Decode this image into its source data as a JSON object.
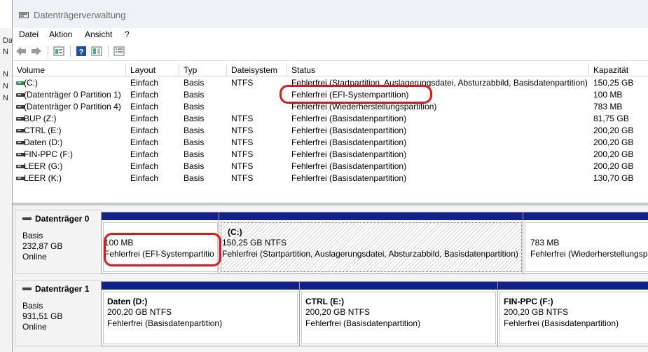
{
  "window": {
    "title": "Datenträgerverwaltung"
  },
  "bg_window": {
    "texts": [
      "Da",
      "N",
      "N",
      "N",
      "N"
    ]
  },
  "menu": [
    "Datei",
    "Aktion",
    "Ansicht",
    "?"
  ],
  "toolbar": {
    "icons": [
      "back-arrow-icon",
      "forward-arrow-icon",
      "properties-icon",
      "help-icon",
      "view-icon",
      "list-icon"
    ]
  },
  "volume_list": {
    "columns": [
      "Volume",
      "Layout",
      "Typ",
      "Dateisystem",
      "Status",
      "Kapazität"
    ],
    "rows": [
      {
        "volume": "(C:)",
        "layout": "Einfach",
        "typ": "Basis",
        "fs": "NTFS",
        "status": "Fehlerfrei (Startpartition, Auslagerungsdatei, Absturzabbild, Basisdatenpartition)",
        "cap": "150,25 GB"
      },
      {
        "volume": "(Datenträger 0 Partition 1)",
        "layout": "Einfach",
        "typ": "Basis",
        "fs": "",
        "status": "Fehlerfrei (EFI-Systempartition)",
        "cap": "100 MB"
      },
      {
        "volume": "(Datenträger 0 Partition 4)",
        "layout": "Einfach",
        "typ": "Basis",
        "fs": "",
        "status": "Fehlerfrei (Wiederherstellungspartition)",
        "cap": "783 MB"
      },
      {
        "volume": "BUP (Z:)",
        "layout": "Einfach",
        "typ": "Basis",
        "fs": "NTFS",
        "status": "Fehlerfrei (Basisdatenpartition)",
        "cap": "81,75 GB"
      },
      {
        "volume": "CTRL (E:)",
        "layout": "Einfach",
        "typ": "Basis",
        "fs": "NTFS",
        "status": "Fehlerfrei (Basisdatenpartition)",
        "cap": "200,20 GB"
      },
      {
        "volume": "Daten (D:)",
        "layout": "Einfach",
        "typ": "Basis",
        "fs": "NTFS",
        "status": "Fehlerfrei (Basisdatenpartition)",
        "cap": "200,20 GB"
      },
      {
        "volume": "FIN-PPC (F:)",
        "layout": "Einfach",
        "typ": "Basis",
        "fs": "NTFS",
        "status": "Fehlerfrei (Basisdatenpartition)",
        "cap": "200,20 GB"
      },
      {
        "volume": "LEER (G:)",
        "layout": "Einfach",
        "typ": "Basis",
        "fs": "NTFS",
        "status": "Fehlerfrei (Basisdatenpartition)",
        "cap": "200,20 GB"
      },
      {
        "volume": "LEER (K:)",
        "layout": "Einfach",
        "typ": "Basis",
        "fs": "NTFS",
        "status": "Fehlerfrei (Basisdatenpartition)",
        "cap": "130,70 GB"
      }
    ]
  },
  "disks": [
    {
      "name": "Datenträger 0",
      "type": "Basis",
      "size": "232,87 GB",
      "state": "Online",
      "partitions": [
        {
          "label": "",
          "size": "100 MB",
          "status": "Fehlerfrei (EFI-Systempartitio"
        },
        {
          "label": "(C:)",
          "size": "150,25 GB NTFS",
          "status": "Fehlerfrei (Startpartition, Auslagerungsdatei, Absturzabbild, Basisdatenpartition)"
        },
        {
          "label": "",
          "size": "783 MB",
          "status": "Fehlerfrei (Wiederherstellungspa"
        }
      ]
    },
    {
      "name": "Datenträger 1",
      "type": "Basis",
      "size": "931,51 GB",
      "state": "Online",
      "partitions": [
        {
          "label": "Daten  (D:)",
          "size": "200,20 GB NTFS",
          "status": "Fehlerfrei (Basisdatenpartition)"
        },
        {
          "label": "CTRL  (E:)",
          "size": "200,20 GB NTFS",
          "status": "Fehlerfrei (Basisdatenpartition)"
        },
        {
          "label": "FIN-PPC  (F:)",
          "size": "200,20 GB NTFS",
          "status": "Fehlerfrei (Basisdatenpartition)"
        }
      ]
    }
  ],
  "colors": {
    "partition_bar": "#12208c",
    "highlight": "#e0161c"
  }
}
